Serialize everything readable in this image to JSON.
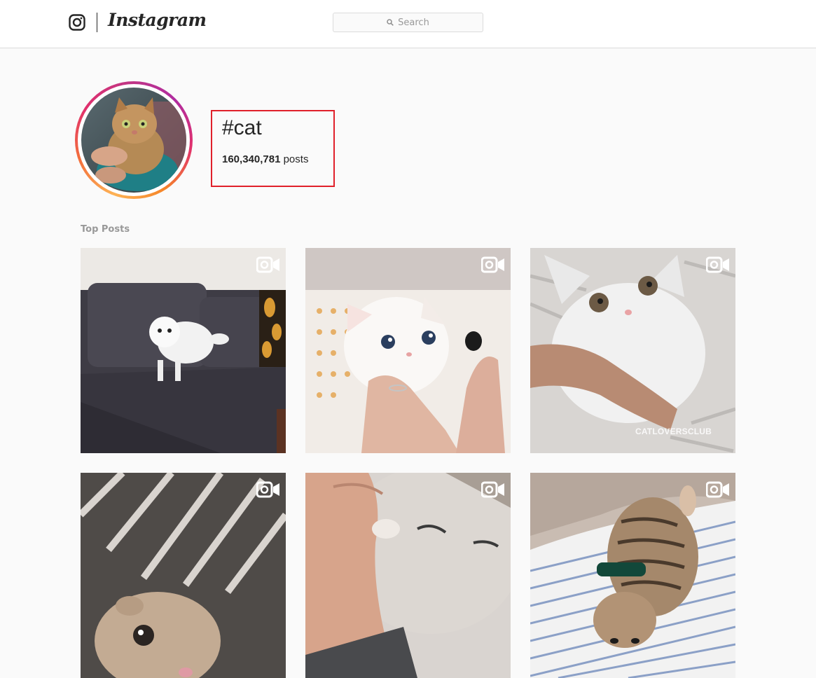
{
  "nav": {
    "logo_text": "Instagram",
    "search_placeholder": "Search"
  },
  "hashtag": {
    "name": "#cat",
    "post_count": "160,340,781",
    "post_label": "posts"
  },
  "top_posts": {
    "title": "Top Posts",
    "items": [
      {
        "type": "video",
        "subject": "white kitten on sofa",
        "watermark": ""
      },
      {
        "type": "video",
        "subject": "white kitten held in hands",
        "watermark": ""
      },
      {
        "type": "video",
        "subject": "white cat held in arm",
        "watermark": "CATLOVERSCLUB"
      },
      {
        "type": "video",
        "subject": "grey cat under striped blanket",
        "watermark": ""
      },
      {
        "type": "video",
        "subject": "cat nuzzling hand",
        "watermark": ""
      },
      {
        "type": "video",
        "subject": "tabby kitten on striped blanket",
        "watermark": ""
      }
    ]
  },
  "colors": {
    "highlight": "#e0202a",
    "ring_start": "#fdb255",
    "ring_end": "#c13584",
    "muted_text": "#999999"
  },
  "icons": [
    "instagram-glyph-icon",
    "search-icon",
    "video-icon"
  ]
}
